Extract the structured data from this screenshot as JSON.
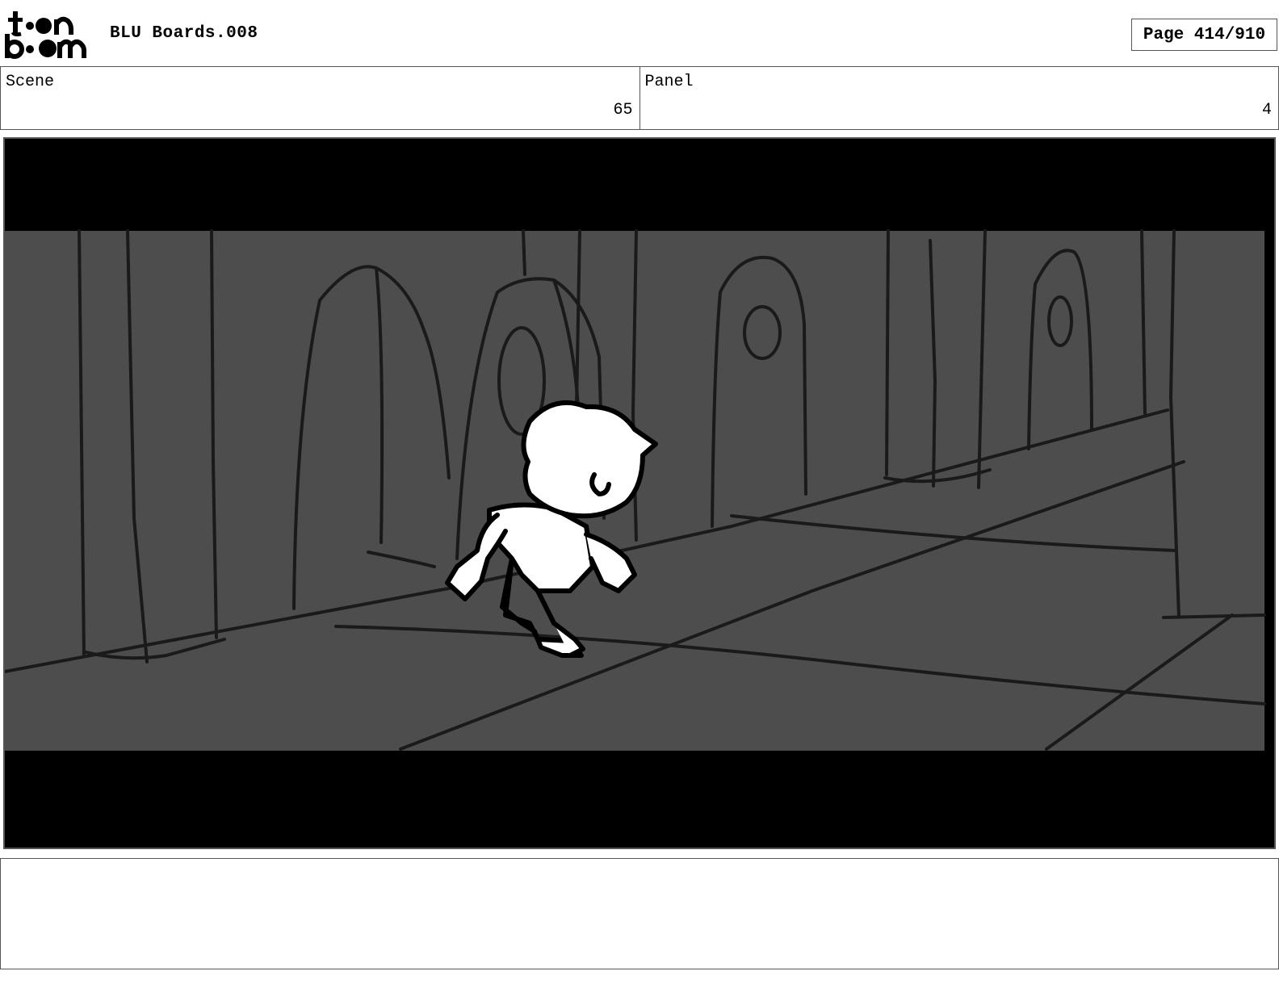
{
  "header": {
    "logo_text_top": "toon",
    "logo_text_bottom": "boom",
    "title": "BLU Boards.008",
    "page_label": "Page 414/910"
  },
  "info": {
    "scene_label": "Scene",
    "scene_value": "65",
    "panel_label": "Panel",
    "panel_value": "4"
  },
  "panel_image": {
    "icon": "storyboard-sketch-image",
    "background_color": "#4d4d4d",
    "letterbox_color": "#000000",
    "line_color": "#1a1a1a"
  },
  "notes": {
    "text": ""
  }
}
